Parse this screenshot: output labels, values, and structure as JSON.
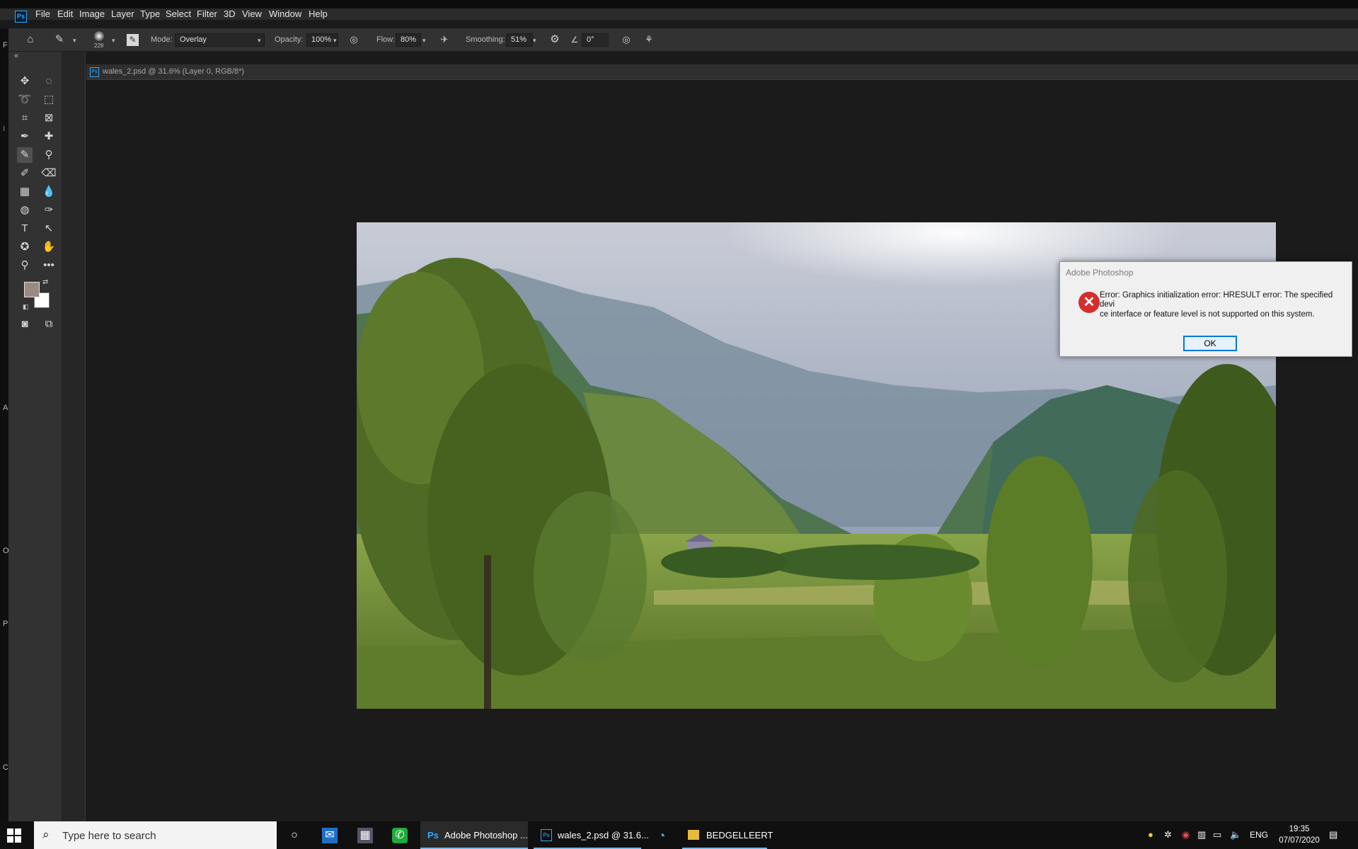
{
  "menu": {
    "items": [
      "File",
      "Edit",
      "Image",
      "Layer",
      "Type",
      "Select",
      "Filter",
      "3D",
      "View",
      "Window",
      "Help"
    ]
  },
  "options": {
    "brush_size": "228",
    "mode_label": "Mode:",
    "mode_value": "Overlay",
    "opacity_label": "Opacity:",
    "opacity_value": "100%",
    "flow_label": "Flow:",
    "flow_value": "80%",
    "smoothing_label": "Smoothing:",
    "smoothing_value": "51%",
    "angle_value": "0°"
  },
  "left_strip_letters": [
    "F",
    "I",
    "A",
    "O",
    "P",
    "C"
  ],
  "document": {
    "tab_title": "wales_2.psd @ 31.6% (Layer 0, RGB/8*)",
    "ps_badge": "Ps"
  },
  "swatches": {
    "foreground": "#9a8b82",
    "background": "#ffffff"
  },
  "dialog": {
    "title": "Adobe Photoshop",
    "message_line1": "Error: Graphics initialization error: HRESULT error: The specified devi",
    "message_line2": "ce interface or feature level is not supported on this system.",
    "ok_label": "OK"
  },
  "taskbar": {
    "search_placeholder": "Type here to search",
    "apps": [
      {
        "label": "Adobe Photoshop ..."
      },
      {
        "label": "wales_2.psd @ 31.6..."
      },
      {
        "label": "BEDGELLEERT"
      }
    ],
    "language": "ENG",
    "time": "19:35",
    "date": "07/07/2020"
  }
}
